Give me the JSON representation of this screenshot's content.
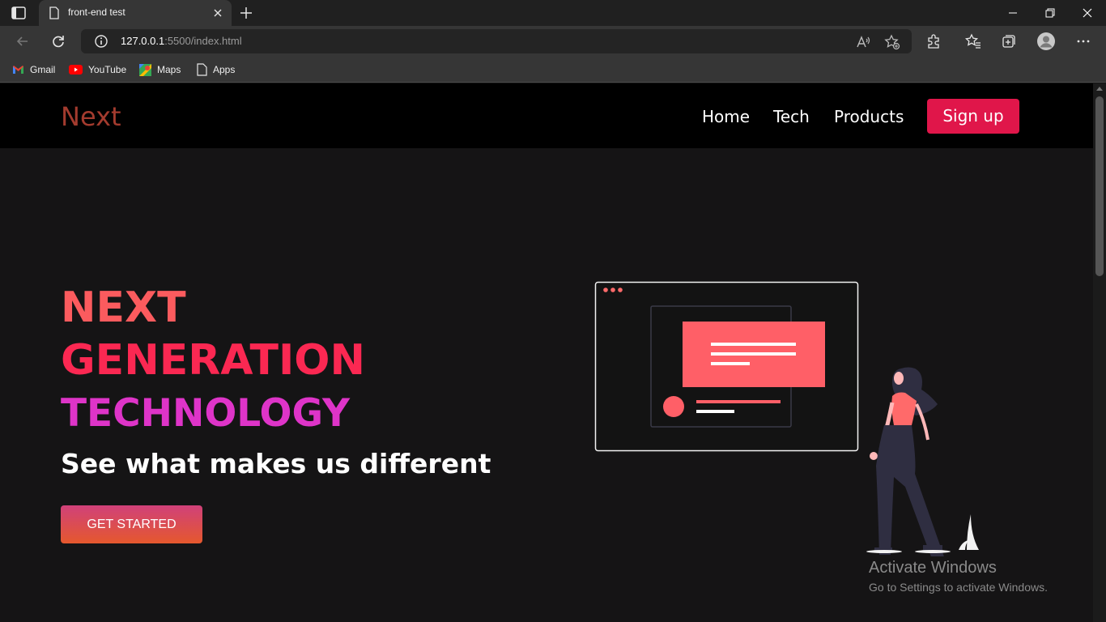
{
  "browser": {
    "tab_title": "front-end test",
    "url_host": "127.0.0.1",
    "url_rest": ":5500/index.html",
    "bookmarks": [
      {
        "label": "Gmail",
        "icon": "gmail-icon"
      },
      {
        "label": "YouTube",
        "icon": "youtube-icon"
      },
      {
        "label": "Maps",
        "icon": "maps-icon"
      },
      {
        "label": "Apps",
        "icon": "page-icon"
      }
    ]
  },
  "site": {
    "logo": "Next",
    "nav": [
      "Home",
      "Tech",
      "Products"
    ],
    "signup_label": "Sign up",
    "hero": {
      "line1": "NEXT",
      "line2": "GENERATION",
      "line3": "TECHNOLOGY",
      "tagline": "See what makes us different",
      "cta_label": "GET STARTED"
    }
  },
  "watermark": {
    "title": "Activate Windows",
    "subtitle": "Go to Settings to activate Windows."
  },
  "colors": {
    "accent": "#e0164a",
    "logo": "#a33b2e",
    "hero_line1": "#fb5b5e",
    "hero_line2": "#fb2852",
    "hero_line3": "#de34c8"
  }
}
